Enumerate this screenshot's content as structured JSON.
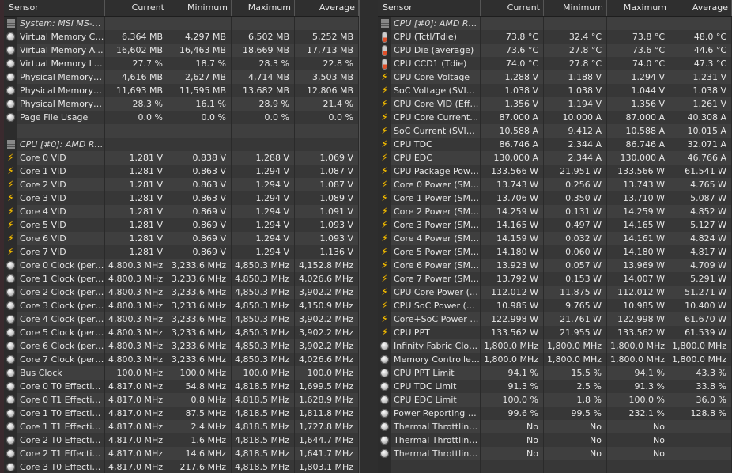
{
  "headers": [
    "Sensor",
    "Current",
    "Minimum",
    "Maximum",
    "Average"
  ],
  "left": {
    "rows": [
      {
        "type": "group",
        "icon": "chip",
        "label": "System: MSI MS-7...",
        "values": [
          "",
          "",
          "",
          ""
        ]
      },
      {
        "icon": "clock",
        "label": "Virtual Memory Co...",
        "values": [
          "6,364 MB",
          "4,297 MB",
          "6,502 MB",
          "5,252 MB"
        ]
      },
      {
        "icon": "clock",
        "label": "Virtual Memory Ava...",
        "values": [
          "16,602 MB",
          "16,463 MB",
          "18,669 MB",
          "17,713 MB"
        ]
      },
      {
        "icon": "clock",
        "label": "Virtual Memory Load",
        "values": [
          "27.7 %",
          "18.7 %",
          "28.3 %",
          "22.8 %"
        ]
      },
      {
        "icon": "clock",
        "label": "Physical Memory U...",
        "values": [
          "4,616 MB",
          "2,627 MB",
          "4,714 MB",
          "3,503 MB"
        ]
      },
      {
        "icon": "clock",
        "label": "Physical Memory A...",
        "values": [
          "11,693 MB",
          "11,595 MB",
          "13,682 MB",
          "12,806 MB"
        ]
      },
      {
        "icon": "clock",
        "label": "Physical Memory Load",
        "values": [
          "28.3 %",
          "16.1 %",
          "28.9 %",
          "21.4 %"
        ]
      },
      {
        "icon": "clock",
        "label": "Page File Usage",
        "values": [
          "0.0 %",
          "0.0 %",
          "0.0 %",
          "0.0 %"
        ]
      },
      {
        "type": "blank",
        "icon": "",
        "label": "",
        "values": [
          "",
          "",
          "",
          ""
        ]
      },
      {
        "type": "group",
        "icon": "chip",
        "label": "CPU [#0]: AMD Ry...",
        "values": [
          "",
          "",
          "",
          ""
        ]
      },
      {
        "icon": "bolt",
        "label": "Core 0 VID",
        "values": [
          "1.281 V",
          "0.838 V",
          "1.288 V",
          "1.069 V"
        ]
      },
      {
        "icon": "bolt",
        "label": "Core 1 VID",
        "values": [
          "1.281 V",
          "0.863 V",
          "1.294 V",
          "1.087 V"
        ]
      },
      {
        "icon": "bolt",
        "label": "Core 2 VID",
        "values": [
          "1.281 V",
          "0.863 V",
          "1.294 V",
          "1.087 V"
        ]
      },
      {
        "icon": "bolt",
        "label": "Core 3 VID",
        "values": [
          "1.281 V",
          "0.863 V",
          "1.294 V",
          "1.089 V"
        ]
      },
      {
        "icon": "bolt",
        "label": "Core 4 VID",
        "values": [
          "1.281 V",
          "0.869 V",
          "1.294 V",
          "1.091 V"
        ]
      },
      {
        "icon": "bolt",
        "label": "Core 5 VID",
        "values": [
          "1.281 V",
          "0.869 V",
          "1.294 V",
          "1.093 V"
        ]
      },
      {
        "icon": "bolt",
        "label": "Core 6 VID",
        "values": [
          "1.281 V",
          "0.869 V",
          "1.294 V",
          "1.093 V"
        ]
      },
      {
        "icon": "bolt",
        "label": "Core 7 VID",
        "values": [
          "1.281 V",
          "0.869 V",
          "1.294 V",
          "1.136 V"
        ]
      },
      {
        "icon": "clock",
        "label": "Core 0 Clock (perf ...",
        "values": [
          "4,800.3 MHz",
          "3,233.6 MHz",
          "4,850.3 MHz",
          "4,152.8 MHz"
        ]
      },
      {
        "icon": "clock",
        "label": "Core 1 Clock (perf ...",
        "values": [
          "4,800.3 MHz",
          "3,233.6 MHz",
          "4,850.3 MHz",
          "4,026.6 MHz"
        ]
      },
      {
        "icon": "clock",
        "label": "Core 2 Clock (perf ...",
        "values": [
          "4,800.3 MHz",
          "3,233.6 MHz",
          "4,850.3 MHz",
          "3,902.2 MHz"
        ]
      },
      {
        "icon": "clock",
        "label": "Core 3 Clock (perf ...",
        "values": [
          "4,800.3 MHz",
          "3,233.6 MHz",
          "4,850.3 MHz",
          "4,150.9 MHz"
        ]
      },
      {
        "icon": "clock",
        "label": "Core 4 Clock (perf ...",
        "values": [
          "4,800.3 MHz",
          "3,233.6 MHz",
          "4,850.3 MHz",
          "3,902.2 MHz"
        ]
      },
      {
        "icon": "clock",
        "label": "Core 5 Clock (perf ...",
        "values": [
          "4,800.3 MHz",
          "3,233.6 MHz",
          "4,850.3 MHz",
          "3,902.2 MHz"
        ]
      },
      {
        "icon": "clock",
        "label": "Core 6 Clock (perf ...",
        "values": [
          "4,800.3 MHz",
          "3,233.6 MHz",
          "4,850.3 MHz",
          "3,902.2 MHz"
        ]
      },
      {
        "icon": "clock",
        "label": "Core 7 Clock (perf ...",
        "values": [
          "4,800.3 MHz",
          "3,233.6 MHz",
          "4,850.3 MHz",
          "4,026.6 MHz"
        ]
      },
      {
        "icon": "clock",
        "label": "Bus Clock",
        "values": [
          "100.0 MHz",
          "100.0 MHz",
          "100.0 MHz",
          "100.0 MHz"
        ]
      },
      {
        "icon": "clock",
        "label": "Core 0 T0 Effective...",
        "values": [
          "4,817.0 MHz",
          "54.8 MHz",
          "4,818.5 MHz",
          "1,699.5 MHz"
        ]
      },
      {
        "icon": "clock",
        "label": "Core 0 T1 Effective...",
        "values": [
          "4,817.0 MHz",
          "0.8 MHz",
          "4,818.5 MHz",
          "1,628.9 MHz"
        ]
      },
      {
        "icon": "clock",
        "label": "Core 1 T0 Effective...",
        "values": [
          "4,817.0 MHz",
          "87.5 MHz",
          "4,818.5 MHz",
          "1,811.8 MHz"
        ]
      },
      {
        "icon": "clock",
        "label": "Core 1 T1 Effective...",
        "values": [
          "4,817.0 MHz",
          "2.4 MHz",
          "4,818.5 MHz",
          "1,727.8 MHz"
        ]
      },
      {
        "icon": "clock",
        "label": "Core 2 T0 Effective...",
        "values": [
          "4,817.0 MHz",
          "1.6 MHz",
          "4,818.5 MHz",
          "1,644.7 MHz"
        ]
      },
      {
        "icon": "clock",
        "label": "Core 2 T1 Effective...",
        "values": [
          "4,817.0 MHz",
          "14.6 MHz",
          "4,818.5 MHz",
          "1,641.7 MHz"
        ]
      },
      {
        "icon": "clock",
        "label": "Core 3 T0 Effective...",
        "values": [
          "4,817.0 MHz",
          "217.6 MHz",
          "4,818.5 MHz",
          "1,803.1 MHz"
        ]
      }
    ]
  },
  "right": {
    "rows": [
      {
        "type": "group",
        "icon": "chip",
        "label": "CPU [#0]: AMD Ry...",
        "values": [
          "",
          "",
          "",
          ""
        ]
      },
      {
        "icon": "therm",
        "label": "CPU (Tctl/Tdie)",
        "values": [
          "73.8 °C",
          "32.4 °C",
          "73.8 °C",
          "48.0 °C"
        ]
      },
      {
        "icon": "therm",
        "label": "CPU Die (average)",
        "values": [
          "73.6 °C",
          "27.8 °C",
          "73.6 °C",
          "44.6 °C"
        ]
      },
      {
        "icon": "therm",
        "label": "CPU CCD1 (Tdie)",
        "values": [
          "74.0 °C",
          "27.8 °C",
          "74.0 °C",
          "47.3 °C"
        ]
      },
      {
        "icon": "bolt",
        "label": "CPU Core Voltage",
        "values": [
          "1.288 V",
          "1.188 V",
          "1.294 V",
          "1.231 V"
        ]
      },
      {
        "icon": "bolt",
        "label": "SoC Voltage (SVI2 ...",
        "values": [
          "1.038 V",
          "1.038 V",
          "1.044 V",
          "1.038 V"
        ]
      },
      {
        "icon": "bolt",
        "label": "CPU Core VID (Effe...",
        "values": [
          "1.356 V",
          "1.194 V",
          "1.356 V",
          "1.261 V"
        ]
      },
      {
        "icon": "bolt",
        "label": "CPU Core Current (...",
        "values": [
          "87.000 A",
          "10.000 A",
          "87.000 A",
          "40.308 A"
        ]
      },
      {
        "icon": "bolt",
        "label": "SoC Current (SVI2 ...",
        "values": [
          "10.588 A",
          "9.412 A",
          "10.588 A",
          "10.015 A"
        ]
      },
      {
        "icon": "bolt",
        "label": "CPU TDC",
        "values": [
          "86.746 A",
          "2.344 A",
          "86.746 A",
          "32.071 A"
        ]
      },
      {
        "icon": "bolt",
        "label": "CPU EDC",
        "values": [
          "130.000 A",
          "2.344 A",
          "130.000 A",
          "46.766 A"
        ]
      },
      {
        "icon": "bolt",
        "label": "CPU Package Powe...",
        "values": [
          "133.566 W",
          "21.951 W",
          "133.566 W",
          "61.541 W"
        ]
      },
      {
        "icon": "bolt",
        "label": "Core 0 Power (SMU)",
        "values": [
          "13.743 W",
          "0.256 W",
          "13.743 W",
          "4.765 W"
        ]
      },
      {
        "icon": "bolt",
        "label": "Core 1 Power (SMU)",
        "values": [
          "13.706 W",
          "0.350 W",
          "13.710 W",
          "5.087 W"
        ]
      },
      {
        "icon": "bolt",
        "label": "Core 2 Power (SMU)",
        "values": [
          "14.259 W",
          "0.131 W",
          "14.259 W",
          "4.852 W"
        ]
      },
      {
        "icon": "bolt",
        "label": "Core 3 Power (SMU)",
        "values": [
          "14.165 W",
          "0.497 W",
          "14.165 W",
          "5.127 W"
        ]
      },
      {
        "icon": "bolt",
        "label": "Core 4 Power (SMU)",
        "values": [
          "14.159 W",
          "0.032 W",
          "14.161 W",
          "4.824 W"
        ]
      },
      {
        "icon": "bolt",
        "label": "Core 5 Power (SMU)",
        "values": [
          "14.180 W",
          "0.060 W",
          "14.180 W",
          "4.817 W"
        ]
      },
      {
        "icon": "bolt",
        "label": "Core 6 Power (SMU)",
        "values": [
          "13.923 W",
          "0.057 W",
          "13.969 W",
          "4.709 W"
        ]
      },
      {
        "icon": "bolt",
        "label": "Core 7 Power (SMU)",
        "values": [
          "13.792 W",
          "0.153 W",
          "14.007 W",
          "5.291 W"
        ]
      },
      {
        "icon": "bolt",
        "label": "CPU Core Power (S...",
        "values": [
          "112.012 W",
          "11.875 W",
          "112.012 W",
          "51.271 W"
        ]
      },
      {
        "icon": "bolt",
        "label": "CPU SoC Power (S...",
        "values": [
          "10.985 W",
          "9.765 W",
          "10.985 W",
          "10.400 W"
        ]
      },
      {
        "icon": "bolt",
        "label": "Core+SoC Power (...",
        "values": [
          "122.998 W",
          "21.761 W",
          "122.998 W",
          "61.670 W"
        ]
      },
      {
        "icon": "bolt",
        "label": "CPU PPT",
        "values": [
          "133.562 W",
          "21.955 W",
          "133.562 W",
          "61.539 W"
        ]
      },
      {
        "icon": "clock",
        "label": "Infinity Fabric Cloc...",
        "values": [
          "1,800.0 MHz",
          "1,800.0 MHz",
          "1,800.0 MHz",
          "1,800.0 MHz"
        ]
      },
      {
        "icon": "clock",
        "label": "Memory Controller ...",
        "values": [
          "1,800.0 MHz",
          "1,800.0 MHz",
          "1,800.0 MHz",
          "1,800.0 MHz"
        ]
      },
      {
        "icon": "clock",
        "label": "CPU PPT Limit",
        "values": [
          "94.1 %",
          "15.5 %",
          "94.1 %",
          "43.3 %"
        ]
      },
      {
        "icon": "clock",
        "label": "CPU TDC Limit",
        "values": [
          "91.3 %",
          "2.5 %",
          "91.3 %",
          "33.8 %"
        ]
      },
      {
        "icon": "clock",
        "label": "CPU EDC Limit",
        "values": [
          "100.0 %",
          "1.8 %",
          "100.0 %",
          "36.0 %"
        ]
      },
      {
        "icon": "clock",
        "label": "Power Reporting D...",
        "values": [
          "99.6 %",
          "99.5 %",
          "232.1 %",
          "128.8 %"
        ]
      },
      {
        "icon": "clock",
        "label": "Thermal Throttling ...",
        "values": [
          "No",
          "No",
          "No",
          ""
        ]
      },
      {
        "icon": "clock",
        "label": "Thermal Throttling ...",
        "values": [
          "No",
          "No",
          "No",
          ""
        ]
      },
      {
        "icon": "clock",
        "label": "Thermal Throttling ...",
        "values": [
          "No",
          "No",
          "No",
          ""
        ]
      },
      {
        "type": "blank",
        "icon": "",
        "label": "",
        "values": [
          "",
          "",
          "",
          ""
        ]
      }
    ]
  }
}
